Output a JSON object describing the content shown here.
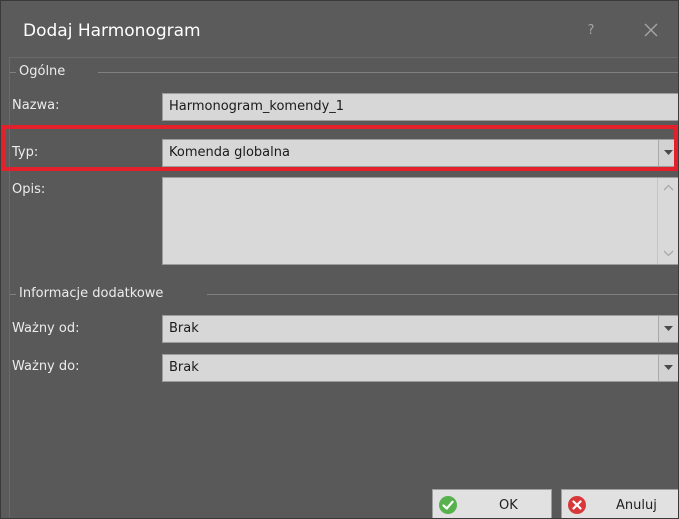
{
  "window": {
    "title": "Dodaj Harmonogram",
    "help_glyph": "?"
  },
  "general": {
    "header": "Ogólne",
    "name_label": "Nazwa:",
    "name_value": "Harmonogram_komendy_1",
    "type_label": "Typ:",
    "type_value": "Komenda globalna",
    "description_label": "Opis:",
    "description_value": ""
  },
  "additional": {
    "header": "Informacje dodatkowe",
    "valid_from_label": "Ważny od:",
    "valid_from_value": "Brak",
    "valid_to_label": "Ważny do:",
    "valid_to_value": "Brak"
  },
  "footer": {
    "ok_label": "OK",
    "cancel_label": "Anuluj"
  },
  "colors": {
    "window_bg": "#5b5b5b",
    "highlight": "#e3202c",
    "ok_icon": "#57b14d",
    "cancel_icon": "#d9383a"
  },
  "icons": [
    "help-icon",
    "close-icon",
    "dropdown-arrow-icon",
    "scroll-up-icon",
    "scroll-down-icon",
    "checkmark-icon",
    "cancel-x-icon"
  ]
}
